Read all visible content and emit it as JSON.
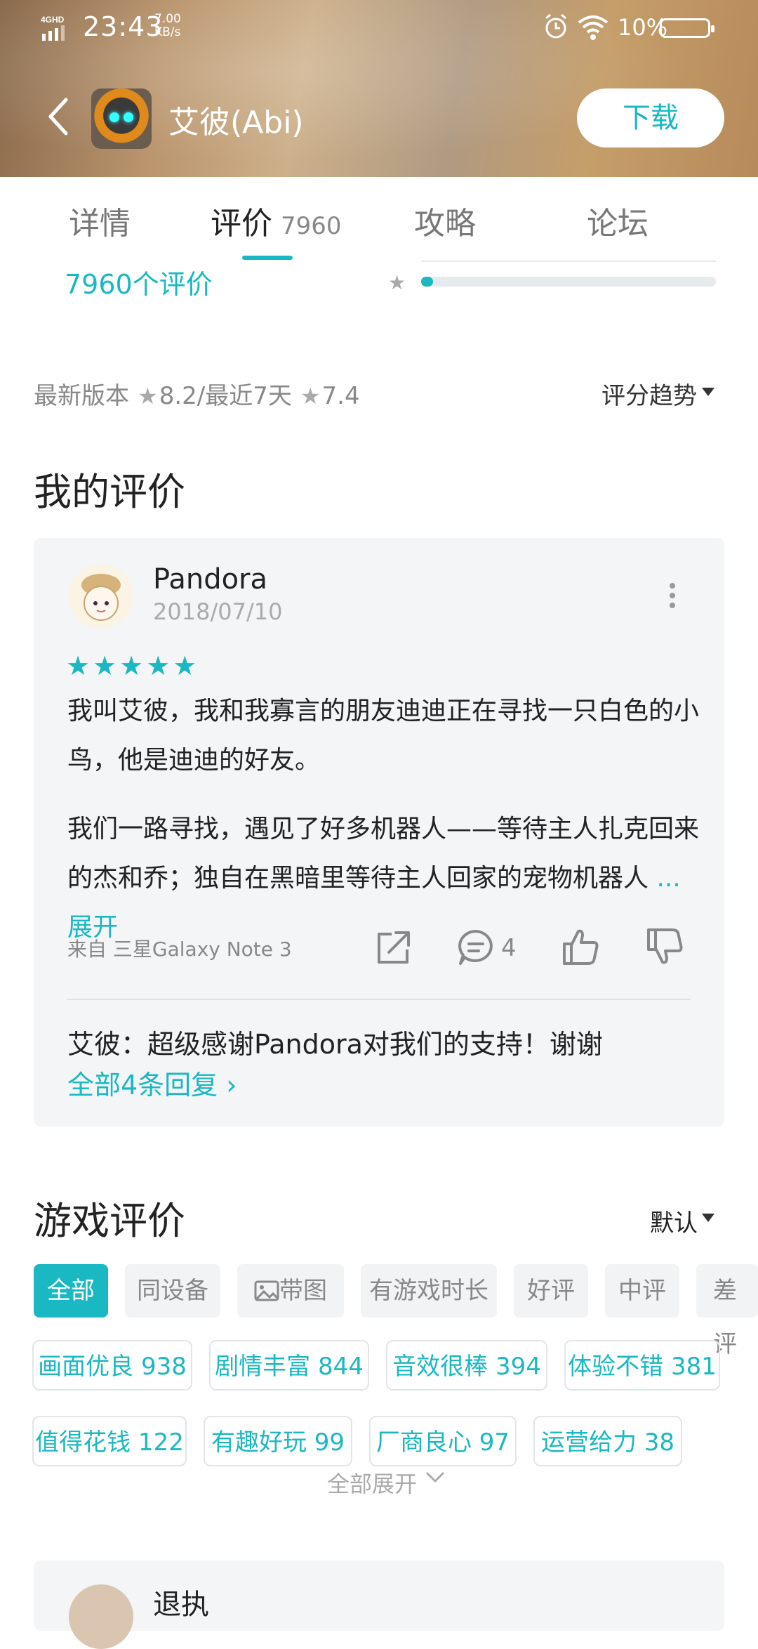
{
  "status_bar": {
    "network": "4GHD",
    "time": "23:43",
    "speed_value": "7.00",
    "speed_unit": "KB/s",
    "battery": "10%"
  },
  "app_header": {
    "title": "艾彼(Abi)",
    "download_label": "下载"
  },
  "tabs": [
    {
      "label": "详情",
      "count": ""
    },
    {
      "label": "评价",
      "count": "7960"
    },
    {
      "label": "攻略",
      "count": ""
    },
    {
      "label": "论坛",
      "count": ""
    }
  ],
  "rating_summary": {
    "total_reviews": "7960个评价",
    "one_star_fraction": 0.04
  },
  "score_line": {
    "latest_label": "最新版本",
    "latest_score": "8.2",
    "recent_label": "/最近7天",
    "recent_score": "7.4",
    "trend_label": "评分趋势"
  },
  "my_review": {
    "section_title": "我的评价",
    "username": "Pandora",
    "date": "2018/07/10",
    "stars": 5,
    "paragraph1": "我叫艾彼，我和我寡言的朋友迪迪正在寻找一只白色的小鸟，他是迪迪的好友。",
    "paragraph2": "我们一路寻找，遇见了好多机器人——等待主人扎克回来的杰和乔；独自在黑暗里等待主人回家的宠物机器人",
    "expand_label": "... 展开",
    "from_device": "来自  三星Galaxy Note 3",
    "comment_count": "4",
    "developer_reply": "艾彼：超级感谢Pandora对我们的支持！谢谢",
    "all_replies_label": "全部4条回复 ›"
  },
  "game_reviews": {
    "section_title": "游戏评价",
    "sort_label": "默认",
    "filters": [
      "全部",
      "同设备",
      "带图",
      "有游戏时长",
      "好评",
      "中评",
      "差评"
    ],
    "tags": [
      "画面优良 938",
      "剧情丰富 844",
      "音效很棒 394",
      "体验不错 381",
      "值得花钱 122",
      "有趣好玩 99",
      "厂商良心 97",
      "运营给力 38"
    ],
    "expand_all_label": "全部展开",
    "next_review_username": "退执"
  },
  "colors": {
    "accent": "#19b8c3",
    "text": "#222222",
    "muted": "#888888",
    "card_bg": "#f4f5f7"
  }
}
